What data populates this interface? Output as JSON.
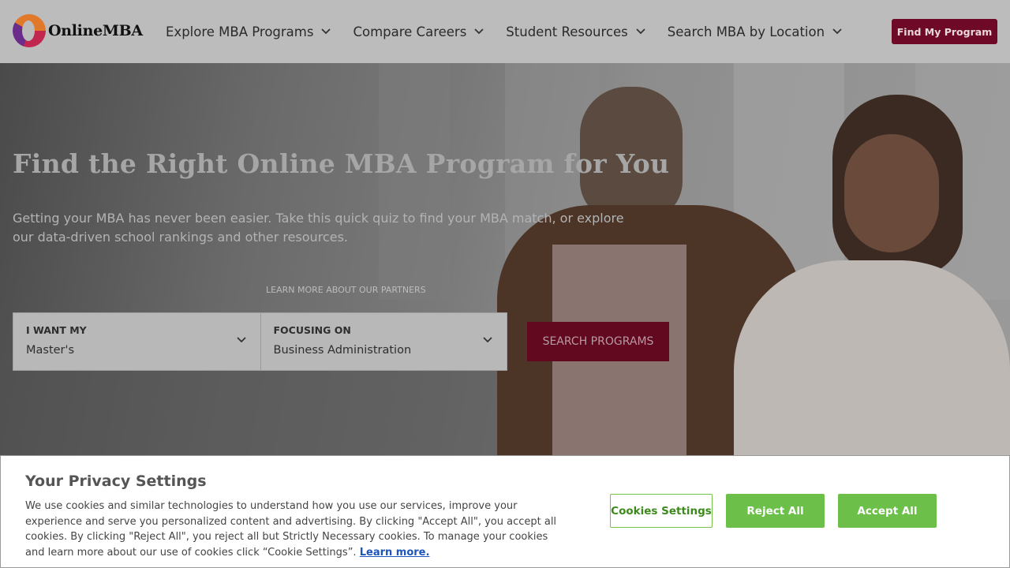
{
  "header": {
    "logo_text": "OnlineMBA",
    "nav": [
      {
        "label": "Explore MBA Programs"
      },
      {
        "label": "Compare Careers"
      },
      {
        "label": "Student Resources"
      },
      {
        "label": "Search MBA by Location"
      }
    ],
    "cta_label": "Find My Program"
  },
  "hero": {
    "title": "Find the Right Online MBA Program for You",
    "subtitle": "Getting your MBA has never been easier. Take this quick quiz to find your MBA match, or explore our data-driven school rankings and other resources.",
    "partners_link": "LEARN MORE ABOUT OUR PARTNERS",
    "degree_field": {
      "label": "I WANT MY",
      "value": "Master's"
    },
    "focus_field": {
      "label": "FOCUSING ON",
      "value": "Business Administration"
    },
    "search_label": "SEARCH PROGRAMS"
  },
  "cookie": {
    "title": "Your Privacy Settings",
    "body": "We use cookies and similar technologies to understand how you use our services, improve your experience and serve you personalized content and advertising. By clicking \"Accept All\", you accept all cookies. By clicking \"Reject All\", you reject all but Strictly Necessary cookies. To manage your cookies and learn more about our use of cookies click “Cookie Settings”.",
    "learn_more": "Learn more.",
    "settings_label": "Cookies Settings",
    "reject_label": "Reject All",
    "accept_label": "Accept All"
  },
  "colors": {
    "brand": "#6e0a28",
    "cookie_accent": "#6cc04a",
    "link": "#1d55b8"
  }
}
